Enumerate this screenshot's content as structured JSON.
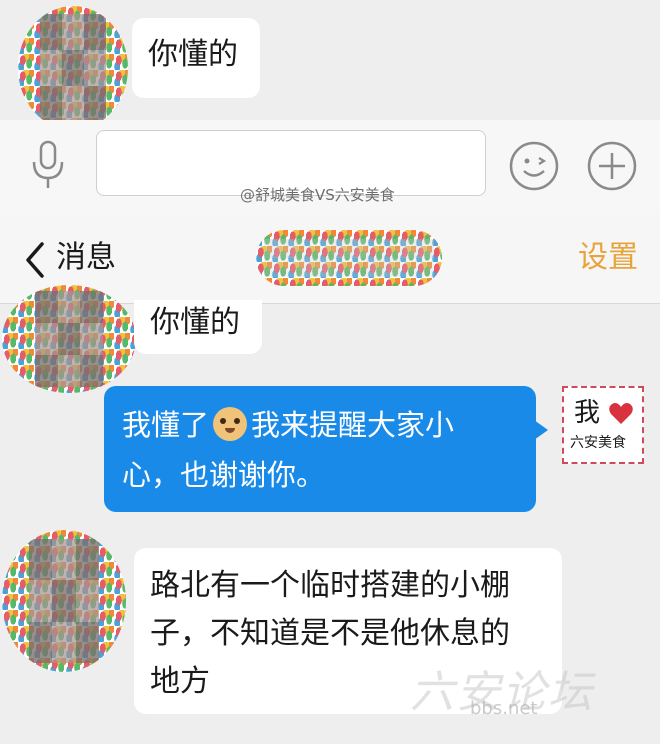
{
  "top_chat": {
    "received_message": "你懂的"
  },
  "input_bar": {
    "text_value": "",
    "icons": [
      "microphone-icon",
      "emoji-smile-icon",
      "plus-icon"
    ]
  },
  "watermark_top": "@舒城美食VS六安美食",
  "nav": {
    "back_label": "消息",
    "settings_label": "设置"
  },
  "chat": {
    "messages": [
      {
        "side": "left",
        "text": "你懂的"
      },
      {
        "side": "right",
        "text_before_emoji": "我懂了",
        "text_after_emoji": "我来提醒大家小",
        "text_line2": "心，也谢谢你。",
        "emoji": "doge-emoji"
      },
      {
        "side": "left",
        "lines": [
          "路北有一个临时搭建的小棚",
          "子，不知道是不是他休息的",
          "地方"
        ]
      }
    ],
    "my_avatar": {
      "line1": "我",
      "line2": "六安美食"
    }
  },
  "watermark_bottom": {
    "logo_text": "六安论坛",
    "url": "bbs.net"
  },
  "colors": {
    "accent_settings": "#e8a33a",
    "sent_bubble": "#1a8ae8",
    "received_bubble": "#ffffff",
    "background": "#eeeeee"
  }
}
